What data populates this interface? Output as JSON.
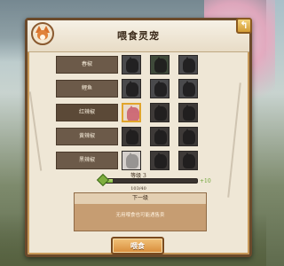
{
  "dialog": {
    "title": "喂食灵宠",
    "close_label": "↰"
  },
  "rows": [
    {
      "label": "春椒",
      "slots": [
        "grey",
        "green",
        "grey"
      ],
      "active": false
    },
    {
      "label": "鲤鱼",
      "slots": [
        "grey",
        "grey",
        "grey"
      ],
      "active": false
    },
    {
      "label": "红辣椒",
      "slots": [
        "active",
        "dark",
        "dark"
      ],
      "active": true
    },
    {
      "label": "黄辣椒",
      "slots": [
        "dark",
        "dark",
        "dark"
      ],
      "active": false
    },
    {
      "label": "黑辣椒",
      "slots": [
        "light",
        "dark",
        "dark"
      ],
      "active": false
    }
  ],
  "level": {
    "text": "等级 3",
    "exp_text": "103/40",
    "exp_gain": "+10",
    "exp_fill_percent": 10
  },
  "next_level": {
    "title": "下一级",
    "description": "无用喂食也可能遇售卖"
  },
  "feed_button": {
    "label": "喂食"
  },
  "colors": {
    "panel_border": "#6b4a2b",
    "accent_gold": "#e1a52c",
    "exp_green": "#79b13a",
    "button_orange": "#d88c3a"
  }
}
